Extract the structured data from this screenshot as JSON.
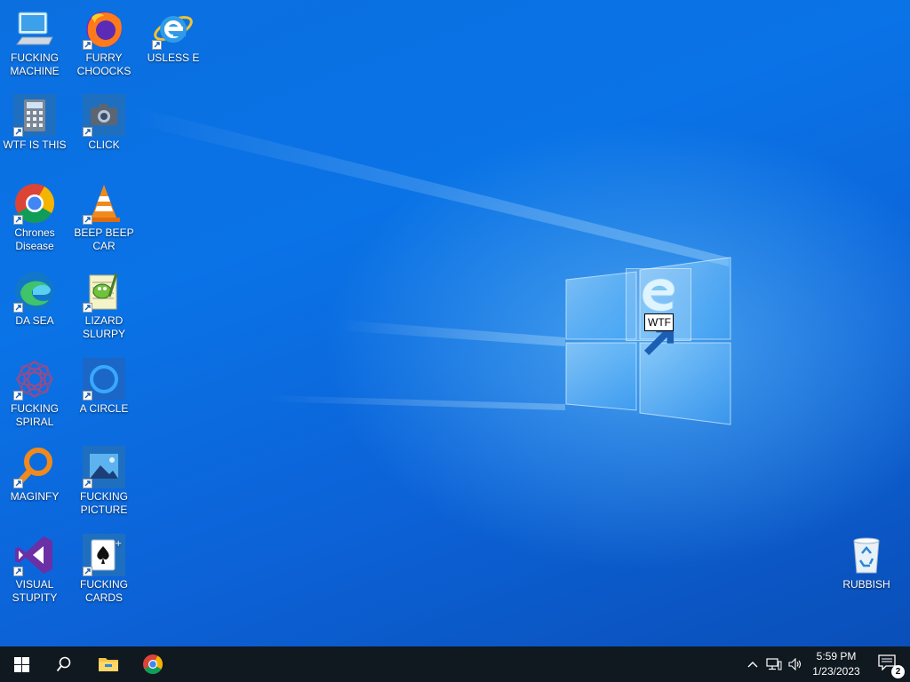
{
  "desktop": {
    "icons": [
      {
        "label": "FUCKING MACHINE",
        "icon": "computer-icon"
      },
      {
        "label": "FURRY CHOOCKS",
        "icon": "firefox-icon"
      },
      {
        "label": "USLESS E",
        "icon": "internet-explorer-icon"
      },
      {
        "label": "WTF IS THIS",
        "icon": "calculator-icon"
      },
      {
        "label": "CLICK",
        "icon": "camera-icon"
      },
      {
        "label": "Chrones Disease",
        "icon": "chrome-icon"
      },
      {
        "label": "BEEP BEEP CAR",
        "icon": "vlc-icon"
      },
      {
        "label": "DA SEA",
        "icon": "edge-icon"
      },
      {
        "label": "LIZARD SLURPY",
        "icon": "notepad-plus-plus-icon"
      },
      {
        "label": "FUCKING SPIRAL",
        "icon": "spiral-icon"
      },
      {
        "label": "A CIRCLE",
        "icon": "cortana-circle-icon"
      },
      {
        "label": "MAGINFY",
        "icon": "magnifier-icon"
      },
      {
        "label": "FUCKING PICTURE",
        "icon": "photos-icon"
      },
      {
        "label": "VISUAL STUPITY",
        "icon": "visual-studio-icon"
      },
      {
        "label": "FUCKING CARDS",
        "icon": "solitaire-cards-icon"
      },
      {
        "label": "RUBBISH",
        "icon": "recycle-bin-icon"
      }
    ],
    "renaming_icon": {
      "value": "WTF",
      "icon": "edge-legacy-icon"
    }
  },
  "taskbar": {
    "start": "windows-start-icon",
    "search": "search-icon",
    "pinned": [
      "file-explorer-icon",
      "chrome-icon"
    ],
    "tray": [
      "chevron-up-icon",
      "network-icon",
      "volume-icon"
    ],
    "time": "5:59 PM",
    "date": "1/23/2023",
    "notifications": "2"
  },
  "colors": {
    "desktop": "#0a6fe0",
    "taskbar": "#101820"
  }
}
